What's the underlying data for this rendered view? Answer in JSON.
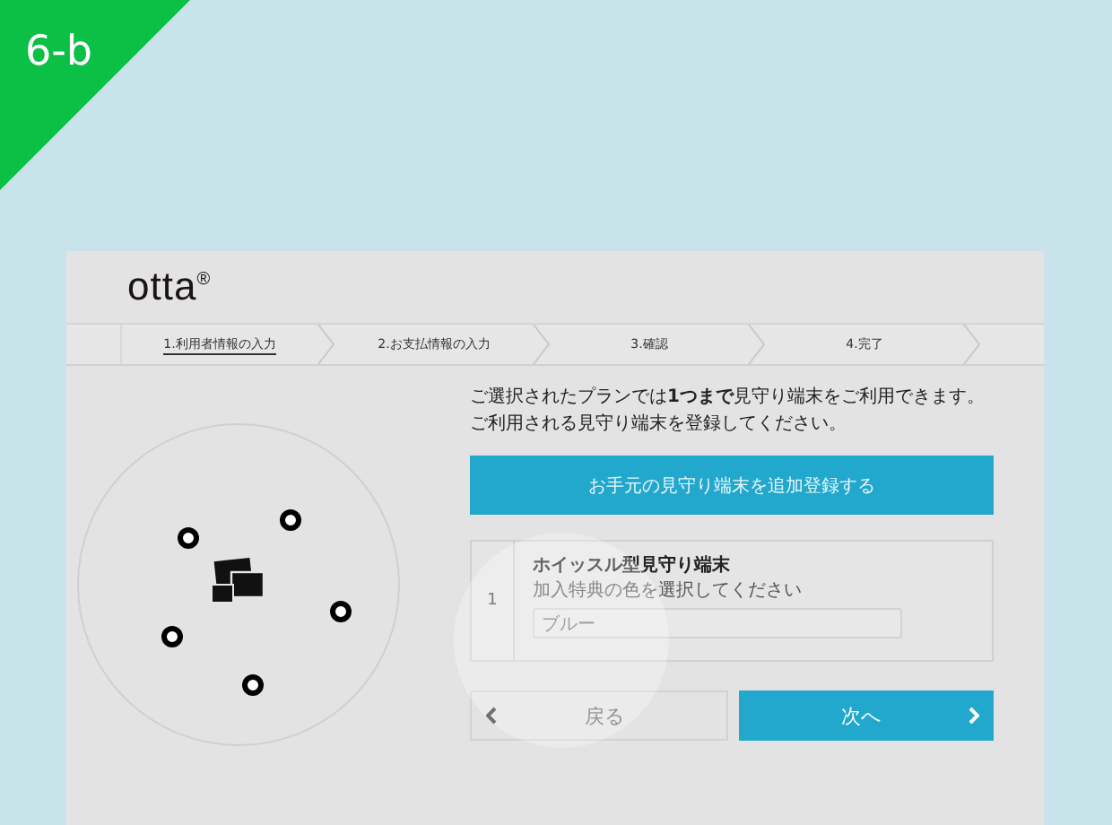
{
  "corner_badge": {
    "label": "6-b"
  },
  "logo": {
    "text": "otta",
    "mark": "®"
  },
  "steps": [
    {
      "label": "1.利用者情報の入力",
      "selected": true
    },
    {
      "label": "2.お支払情報の入力",
      "selected": false
    },
    {
      "label": "3.確認",
      "selected": false
    },
    {
      "label": "4.完了",
      "selected": false
    }
  ],
  "intro": "ご選択されたプランでは**1つまで**見守り端末をご利用できます。ご利用される見守り端末を登録してください。",
  "add_button": {
    "label": "お手元の見守り端末を追加登録する"
  },
  "devices": [
    {
      "number": "1",
      "name": "ホイッスル型見守り端末",
      "hint": "加入特典の色を選択してください",
      "value": "ブルー"
    }
  ],
  "back_button": {
    "label": "戻る",
    "disabled": true
  },
  "next_button": {
    "label": "次へ",
    "disabled": false
  }
}
